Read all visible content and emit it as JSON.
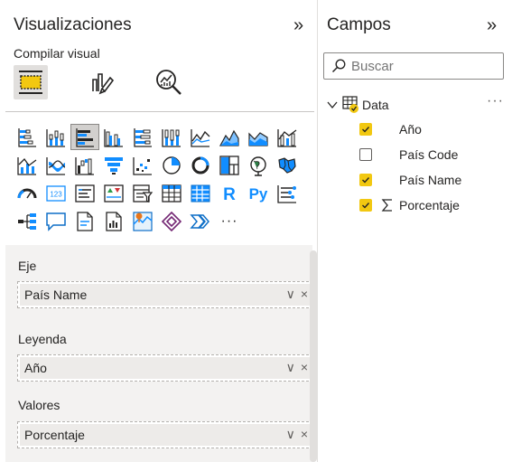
{
  "viz": {
    "title": "Visualizaciones",
    "expand_glyph": "»",
    "subtitle": "Compilar visual",
    "modes": [
      "build-visual-icon",
      "format-visual-icon",
      "analytics-icon"
    ],
    "gallery_rows": [
      [
        "stacked-bar-icon",
        "stacked-column-icon",
        "clustered-bar-icon",
        "clustered-column-icon",
        "100-stacked-bar-icon",
        "100-stacked-column-icon",
        "line-chart-icon",
        "area-chart-icon",
        "stacked-area-icon",
        "line-clustered-column-icon"
      ],
      [
        "line-stacked-column-icon",
        "ribbon-chart-icon",
        "waterfall-icon",
        "funnel-icon",
        "scatter-icon",
        "pie-chart-icon",
        "donut-chart-icon",
        "treemap-icon",
        "map-icon",
        "filled-map-icon"
      ],
      [
        "gauge-icon",
        "card-icon",
        "multi-row-card-icon",
        "kpi-icon",
        "slicer-icon",
        "table-icon",
        "matrix-icon",
        "r-visual-icon",
        "python-visual-icon",
        "key-influencers-icon"
      ],
      [
        "decomposition-tree-icon",
        "qa-icon",
        "smart-narrative-icon",
        "paginated-report-icon",
        "arcgis-icon",
        "power-apps-icon",
        "power-automate-icon",
        "more-visuals-icon"
      ]
    ],
    "selected_visual": "clustered-bar-icon",
    "python_label": "Py",
    "r_label": "R",
    "card_label": "123",
    "more_label": "···",
    "wells": [
      {
        "label": "Eje",
        "value": "País Name"
      },
      {
        "label": "Leyenda",
        "value": "Año"
      },
      {
        "label": "Valores",
        "value": "Porcentaje"
      }
    ],
    "well_controls": {
      "expand": "∨",
      "remove": "×"
    }
  },
  "fields": {
    "title": "Campos",
    "expand_glyph": "»",
    "search_placeholder": "Buscar",
    "table": {
      "name": "Data",
      "expanded": true,
      "more": "···"
    },
    "items": [
      {
        "name": "Año",
        "checked": true,
        "sigma": false
      },
      {
        "name": "País Code",
        "checked": false,
        "sigma": false
      },
      {
        "name": "País Name",
        "checked": true,
        "sigma": false
      },
      {
        "name": "Porcentaje",
        "checked": true,
        "sigma": true
      }
    ]
  },
  "colors": {
    "accent_yellow": "#f2c811",
    "icon_blue": "#118dff",
    "icon_dark": "#252423"
  }
}
